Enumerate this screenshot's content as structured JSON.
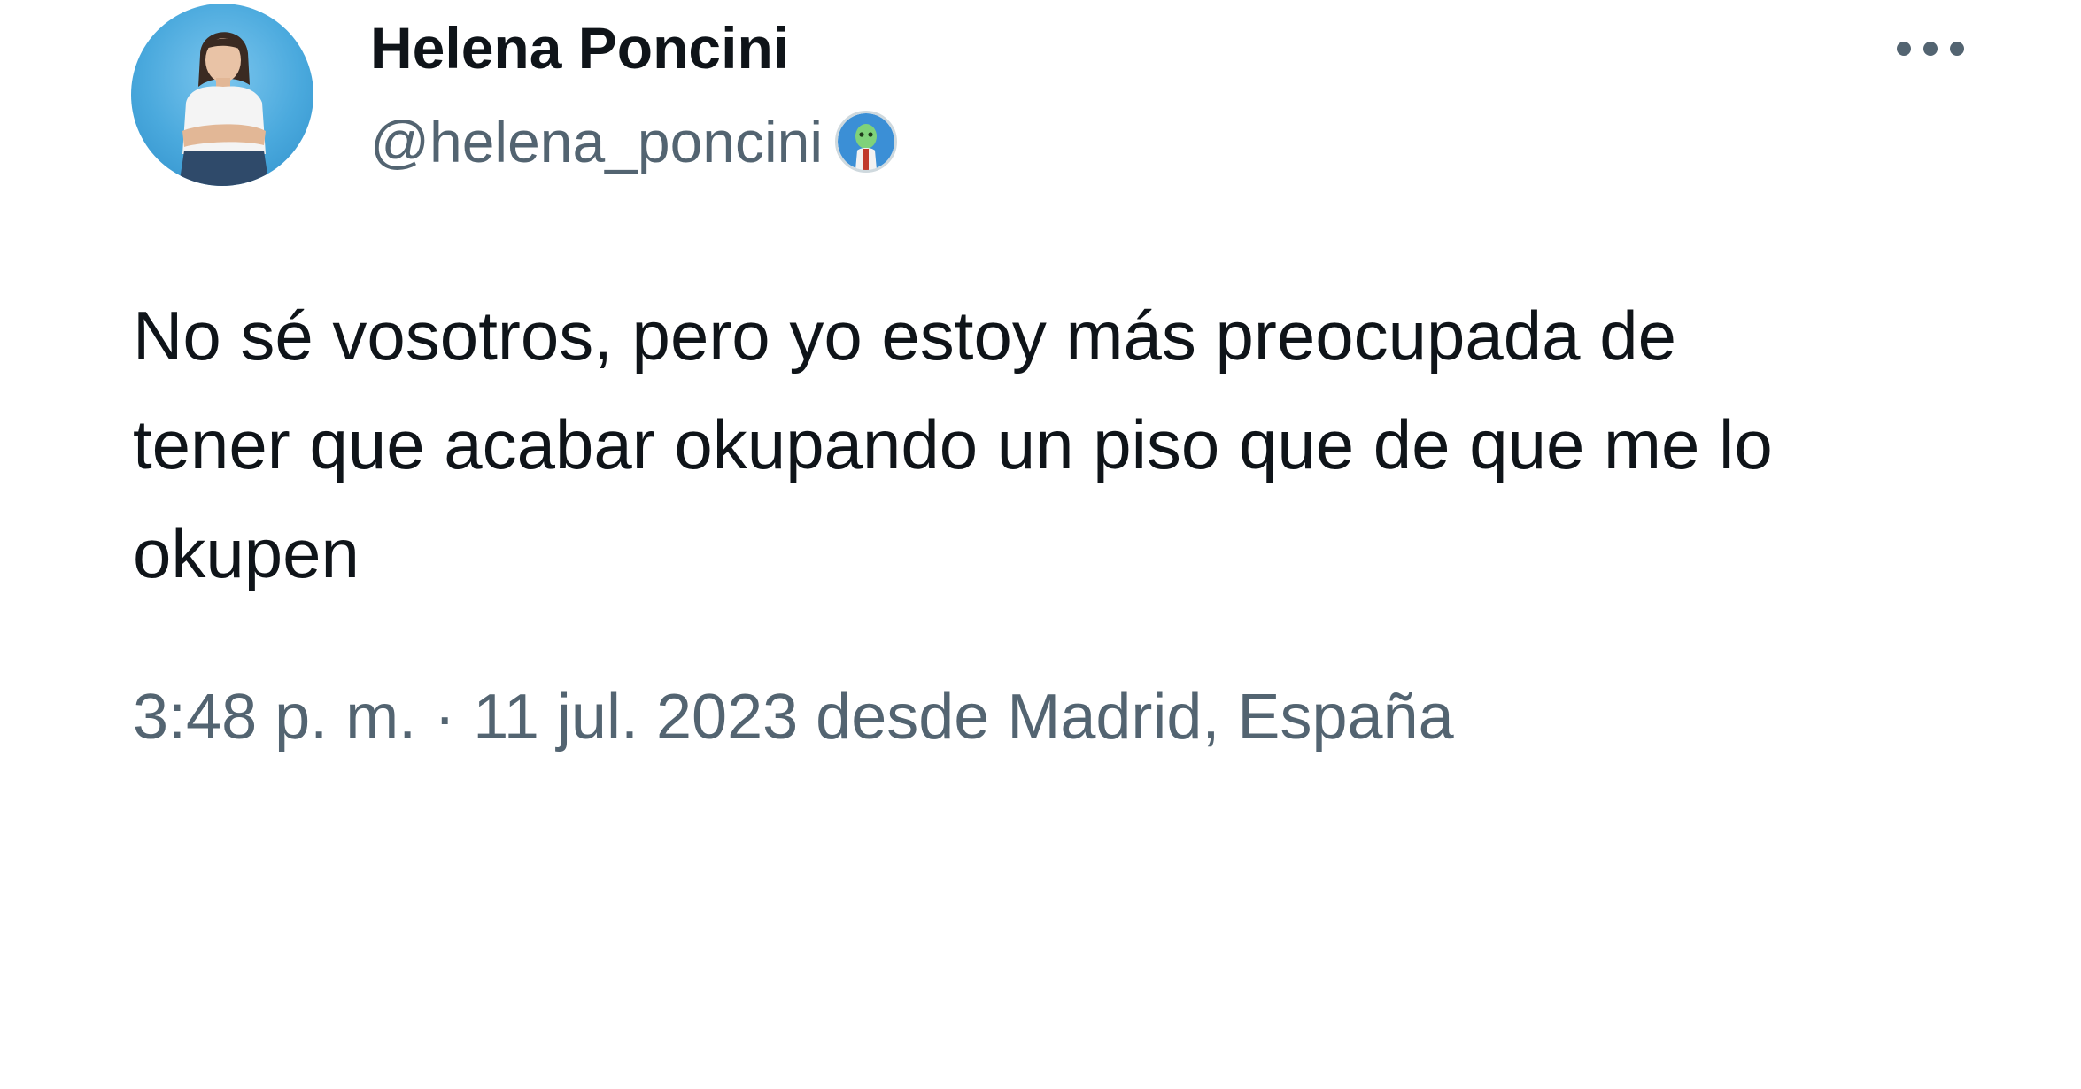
{
  "tweet": {
    "author": {
      "display_name": "Helena Poncini",
      "handle": "@helena_poncini",
      "avatar_icon": "profile-photo",
      "badge_icon": "affiliate-badge-icon"
    },
    "more_icon": "more-horizontal-icon",
    "text": "No sé vosotros, pero yo estoy más preocupada de\ntener que acabar okupando un piso que de que me lo\nokupen",
    "timestamp": {
      "time": "3:48 p. m.",
      "separator": "·",
      "date": "11 jul. 2023",
      "location_text": "desde Madrid, España"
    }
  },
  "colors": {
    "primary_text": "#0f1419",
    "secondary_text": "#536471",
    "background": "#ffffff",
    "avatar_bg": "#4aa9dd"
  }
}
